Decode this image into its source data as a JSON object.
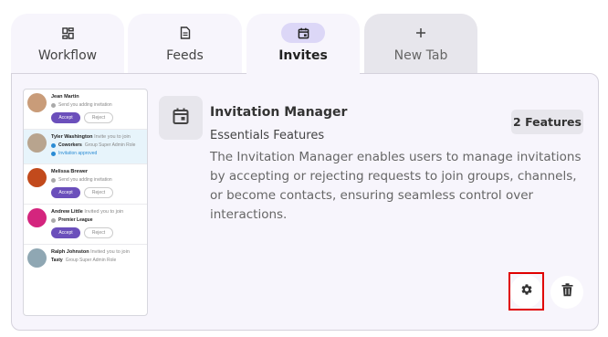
{
  "tabs": [
    {
      "label": "Workflow",
      "icon": "dashboard-icon"
    },
    {
      "label": "Feeds",
      "icon": "document-icon"
    },
    {
      "label": "Invites",
      "icon": "calendar-icon",
      "active": true
    },
    {
      "label": "New Tab",
      "icon": "plus-icon"
    }
  ],
  "feature": {
    "title": "Invitation Manager",
    "subtitle": "Essentials Features",
    "description": "The Invitation Manager enables users to manage invitations by accepting or rejecting requests to join groups, channels, or become contacts, ensuring seamless control over interactions.",
    "badge": "2 Features"
  },
  "preview": {
    "items": [
      {
        "name": "Jean Martin",
        "sub": "",
        "line1": "Send you adding invitation",
        "line2": "",
        "accept": "Accept",
        "reject": "Reject"
      },
      {
        "name": "Tyler Washington",
        "sub": "Invite you to join",
        "line1": "Coworkers",
        "line1_sub": "Group Super Admin Role",
        "status": "Invitation approved"
      },
      {
        "name": "Melissa Brewer",
        "sub": "",
        "line1": "Send you adding invitation",
        "accept": "Accept",
        "reject": "Reject"
      },
      {
        "name": "Andrew Little",
        "sub": "Invited you to join",
        "line1": "Premier League",
        "accept": "Accept",
        "reject": "Reject"
      },
      {
        "name": "Ralph Johnston",
        "sub": "Invited you to join",
        "line1": "Tasty",
        "line1_sub": "Group Super Admin Role"
      }
    ]
  },
  "colors": {
    "accent": "#6b4fbb",
    "highlight": "#e00000",
    "panel": "#f7f5fc"
  }
}
